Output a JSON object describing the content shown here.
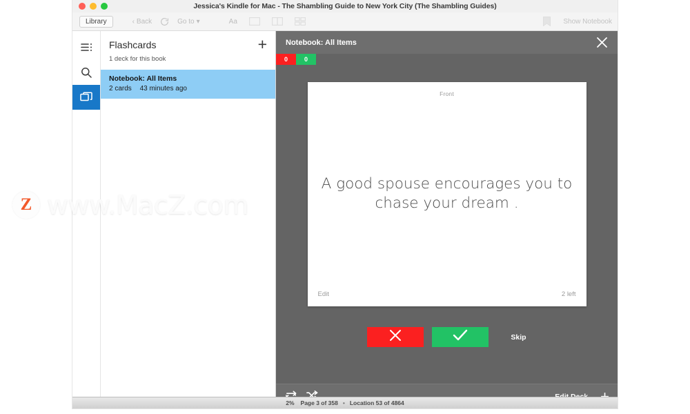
{
  "window": {
    "title": "Jessica's Kindle for Mac - The Shambling Guide to New York City (The Shambling Guides)",
    "traffic_lights": [
      "close-red",
      "minimize-yellow",
      "zoom-green"
    ]
  },
  "toolbar": {
    "library_label": "Library",
    "back_label": "Back",
    "refresh_icon": "refresh-icon",
    "goto_label": "Go to",
    "font_label": "Aa",
    "view_single_icon": "single-page-icon",
    "view_double_icon": "two-column-icon",
    "view_grid_icon": "grid-view-icon",
    "bookmark_icon": "bookmark-icon",
    "show_notebook_label": "Show Notebook"
  },
  "rail": {
    "items": [
      {
        "name": "toc-icon",
        "label": "Table of Contents",
        "active": false
      },
      {
        "name": "search-icon",
        "label": "Search",
        "active": false
      },
      {
        "name": "flashcards-icon",
        "label": "Flashcards",
        "active": true
      }
    ]
  },
  "decks": {
    "title": "Flashcards",
    "add_label": "+",
    "subtitle": "1 deck for this book",
    "items": [
      {
        "name": "Notebook: All Items",
        "cards": "2 cards",
        "updated": "43 minutes ago",
        "selected": true
      }
    ]
  },
  "notebook": {
    "title": "Notebook: All Items",
    "close_icon": "close-icon",
    "scores": [
      {
        "value": "0",
        "color": "#fb2020",
        "name": "incorrect-count"
      },
      {
        "value": "0",
        "color": "#22c265",
        "name": "correct-count"
      }
    ],
    "card": {
      "side_label": "Front",
      "text": "A good spouse encourages you to chase your dream .",
      "edit_label": "Edit",
      "remaining_label": "2 left"
    },
    "actions": {
      "no_icon": "cross-icon",
      "yes_icon": "check-icon",
      "skip_label": "Skip"
    },
    "footer": {
      "repeat_icon": "repeat-icon",
      "shuffle_icon": "shuffle-icon",
      "edit_deck_label": "Edit Deck",
      "add_card_label": "+"
    }
  },
  "statusbar": {
    "percent": "2%",
    "page": "Page 3 of 358",
    "separator": "•",
    "location": "Location 53 of 4864"
  },
  "watermark": {
    "logo": "Z",
    "text": "www.MacZ.com"
  },
  "colors": {
    "accent_blue": "#1878c8",
    "deck_selected": "#8ecdf5",
    "pane_bg": "#646464",
    "pane_bar": "#6e6e6e",
    "red": "#fb2020",
    "green": "#22c265"
  }
}
